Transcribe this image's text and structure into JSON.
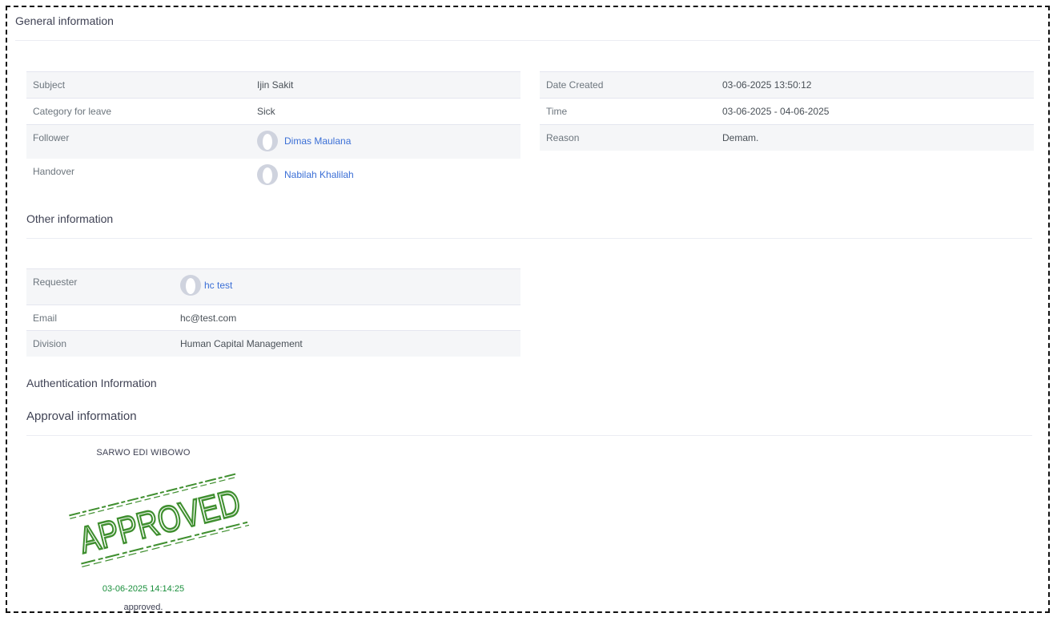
{
  "general": {
    "title": "General information",
    "left": [
      {
        "label": "Subject",
        "value": "Ijin Sakit"
      },
      {
        "label": "Category for leave",
        "value": "Sick"
      },
      {
        "label": "Follower",
        "value": "Dimas Maulana"
      },
      {
        "label": "Handover",
        "value": "Nabilah Khalilah"
      }
    ],
    "right": [
      {
        "label": "Date Created",
        "value": "03-06-2025 13:50:12"
      },
      {
        "label": "Time",
        "value": "03-06-2025 - 04-06-2025"
      },
      {
        "label": "Reason",
        "value": "Demam."
      }
    ]
  },
  "other": {
    "title": "Other information",
    "rows": [
      {
        "label": "Requester",
        "value": "hc test"
      },
      {
        "label": "Email",
        "value": "hc@test.com"
      },
      {
        "label": "Division",
        "value": "Human Capital Management"
      }
    ]
  },
  "auth": {
    "title": "Authentication Information"
  },
  "approval": {
    "title": "Approval information",
    "approver": "SARWO EDI WIBOWO",
    "stamp_text": "APPROVED",
    "date": "03-06-2025 14:14:25",
    "status": "approved.",
    "stamp_color": "#3f8f2f"
  },
  "colors": {
    "link": "#3b6fd6",
    "approved_date": "#1a8f3c",
    "row_alt": "#f5f6f8"
  },
  "icons": {
    "avatar": "user-avatar-icon"
  }
}
